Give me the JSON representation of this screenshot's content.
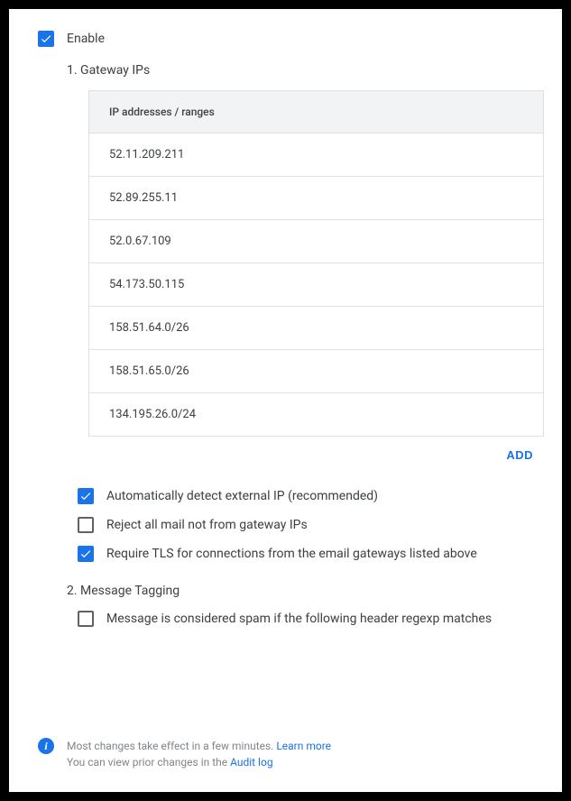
{
  "enable": {
    "label": "Enable",
    "checked": true
  },
  "section1": {
    "heading": "1. Gateway IPs",
    "column_header": "IP addresses / ranges",
    "rows": [
      "52.11.209.211",
      "52.89.255.11",
      "52.0.67.109",
      "54.173.50.115",
      "158.51.64.0/26",
      "158.51.65.0/26",
      "134.195.26.0/24"
    ],
    "add_label": "ADD",
    "options": [
      {
        "label": "Automatically detect external IP (recommended)",
        "checked": true
      },
      {
        "label": "Reject all mail not from gateway IPs",
        "checked": false
      },
      {
        "label": "Require TLS for connections from the email gateways listed above",
        "checked": true
      }
    ]
  },
  "section2": {
    "heading": "2. Message Tagging",
    "options": [
      {
        "label": "Message is considered spam if the following header regexp matches",
        "checked": false
      }
    ]
  },
  "footer": {
    "line1_a": "Most changes take effect in a few minutes. ",
    "learn_more": "Learn more",
    "line2_a": "You can view prior changes in the ",
    "audit_log": "Audit log"
  }
}
